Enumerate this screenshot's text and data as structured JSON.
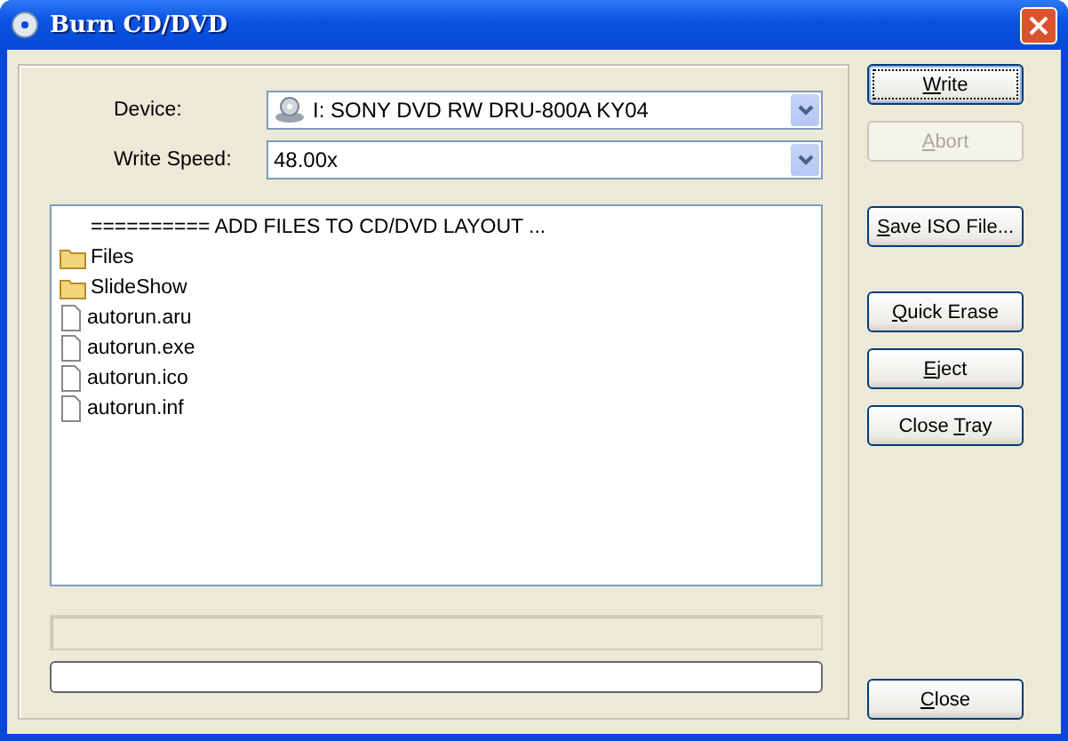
{
  "window": {
    "title": "Burn CD/DVD"
  },
  "device": {
    "label": "Device:",
    "value": "I: SONY DVD RW DRU-800A KY04"
  },
  "write_speed": {
    "label": "Write Speed:",
    "value": "48.00x"
  },
  "layout_list": [
    {
      "kind": "header",
      "name": "========== ADD FILES TO CD/DVD LAYOUT ..."
    },
    {
      "kind": "folder",
      "name": "Files"
    },
    {
      "kind": "folder",
      "name": "SlideShow"
    },
    {
      "kind": "file",
      "name": "autorun.aru"
    },
    {
      "kind": "file",
      "name": "autorun.exe"
    },
    {
      "kind": "file",
      "name": "autorun.ico"
    },
    {
      "kind": "file",
      "name": "autorun.inf"
    }
  ],
  "progress": {
    "level": 0
  },
  "button_groups": [
    [
      {
        "key": "W",
        "post": "rite",
        "disabled": false,
        "default": true
      },
      {
        "key": "A",
        "post": "bort",
        "disabled": true,
        "default": false
      }
    ],
    [
      {
        "key": "S",
        "post": "ave ISO File...",
        "disabled": false,
        "default": false
      }
    ],
    [
      {
        "key": "Q",
        "post": "uick Erase",
        "disabled": false,
        "default": false
      },
      {
        "key": "E",
        "post": "ject",
        "disabled": false,
        "default": false
      },
      {
        "pre": "Close ",
        "key": "T",
        "post": "ray",
        "disabled": false,
        "default": false
      }
    ],
    [
      {
        "key": "C",
        "post": "lose",
        "disabled": false,
        "default": false
      }
    ]
  ]
}
